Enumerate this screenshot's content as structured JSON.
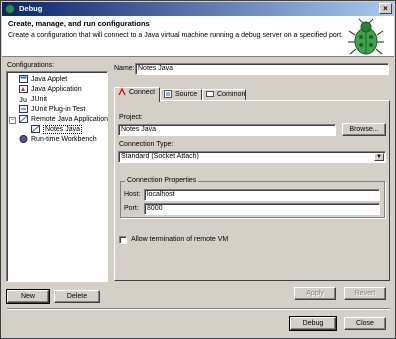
{
  "window": {
    "title": "Debug",
    "close_glyph": "×"
  },
  "header": {
    "title": "Create, manage, and run configurations",
    "subtitle": "Create a configuration that will connect to a Java virtual machine running a debug server on a specified port.",
    "icon": "bug-icon"
  },
  "sidebar": {
    "label": "Configurations:",
    "items": [
      {
        "label": "Java Applet",
        "icon": "java-applet-icon"
      },
      {
        "label": "Java Application",
        "icon": "java-app-icon"
      },
      {
        "label": "JUnit",
        "icon": "junit-icon"
      },
      {
        "label": "JUnit Plug-in Test",
        "icon": "junit-plugin-icon"
      },
      {
        "label": "Remote Java Application",
        "icon": "remote-java-icon",
        "expanded": true
      },
      {
        "label": "Notes Java",
        "icon": "remote-config-icon",
        "selected": true
      },
      {
        "label": "Run-time Workbench",
        "icon": "workbench-icon"
      }
    ],
    "new_label": "New",
    "delete_label": "Delete"
  },
  "config": {
    "name_label": "Name:",
    "name_value": "Notes Java",
    "tabs": [
      {
        "label": "Connect",
        "active": true,
        "icon": "connect-icon"
      },
      {
        "label": "Source",
        "active": false,
        "icon": "source-icon"
      },
      {
        "label": "Common",
        "active": false,
        "icon": "common-icon"
      }
    ],
    "project_label": "Project:",
    "project_value": "Notes Java",
    "browse_label": "Browse...",
    "connection_type_label": "Connection Type:",
    "connection_type_value": "Standard (Socket Attach)",
    "connection_properties_label": "Connection Properties",
    "host_label": "Host:",
    "host_value": "localhost",
    "port_label": "Port:",
    "port_value": "8000",
    "allow_termination_label": "Allow termination of remote VM",
    "allow_termination_checked": false,
    "apply_label": "Apply",
    "revert_label": "Revert"
  },
  "footer": {
    "debug_label": "Debug",
    "close_label": "Close"
  },
  "colors": {
    "titlebar_start": "#08246b",
    "titlebar_end": "#a6caf0",
    "dialog_bg": "#d4d0c8"
  }
}
